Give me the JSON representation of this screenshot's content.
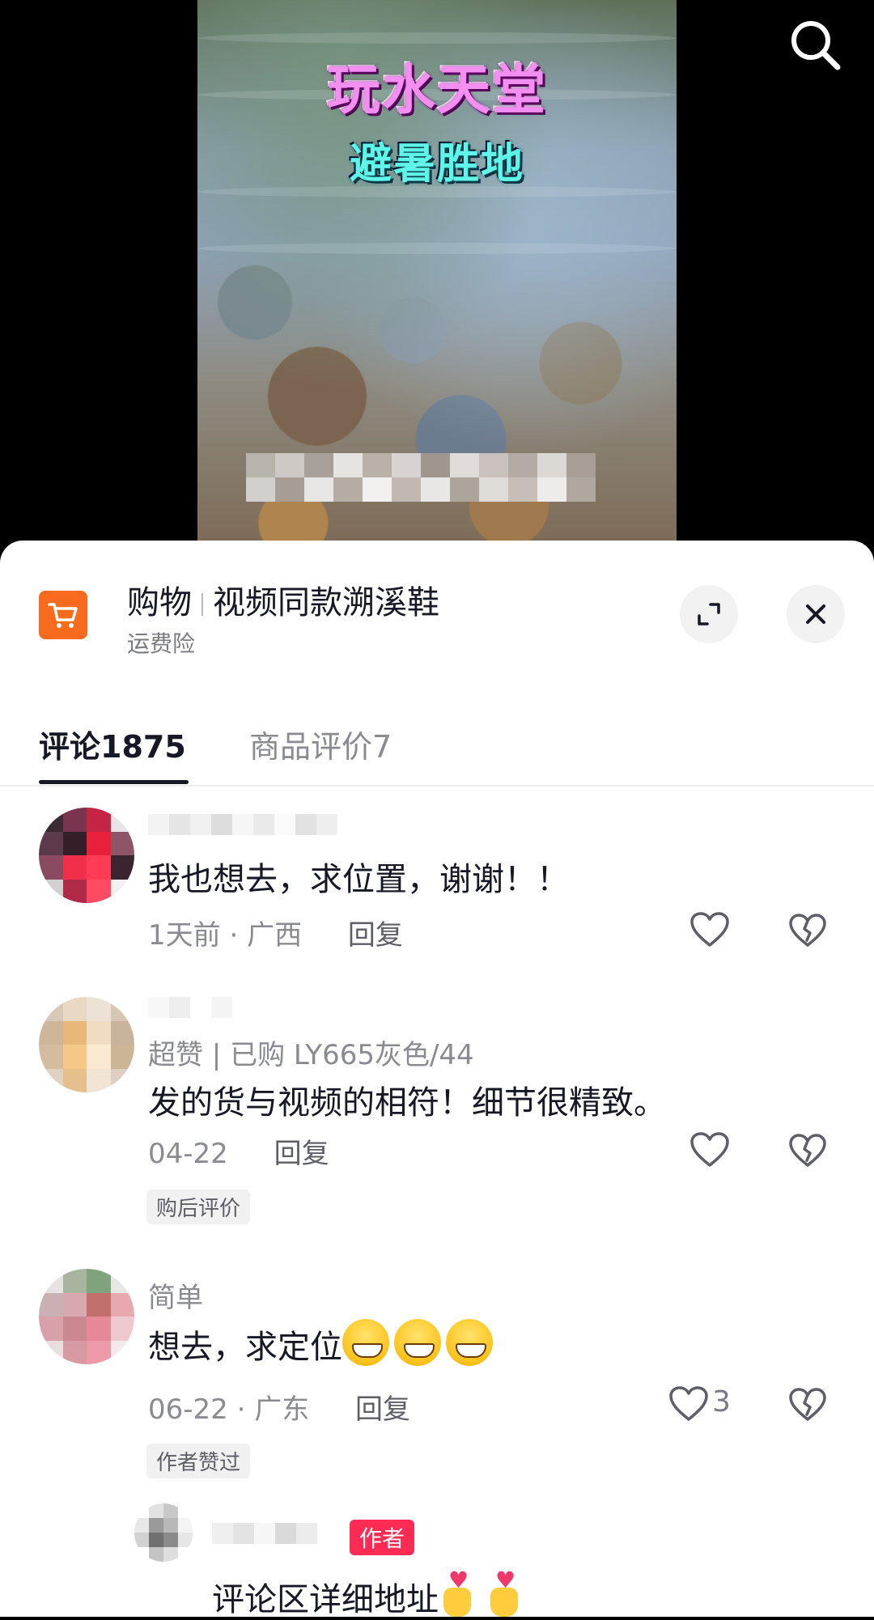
{
  "video": {
    "title": "玩水天堂",
    "subtitle": "避暑胜地"
  },
  "shop": {
    "category": "购物",
    "product": "视频同款溯溪鞋",
    "subtitle": "运费险"
  },
  "tabs": [
    {
      "label": "评论1875",
      "active": true
    },
    {
      "label": "商品评价7",
      "active": false
    }
  ],
  "comments": [
    {
      "text": "我也想去，求位置，谢谢！！",
      "time": "1天前",
      "location": "广西",
      "reply_label": "回复"
    },
    {
      "purchase_info": "超赞 | 已购 LY665灰色/44",
      "text": "发的货与视频的相符！细节很精致。",
      "time": "04-22",
      "reply_label": "回复",
      "tag": "购后评价"
    },
    {
      "username": "简单",
      "text": "想去，求定位",
      "time": "06-22",
      "location": "广东",
      "reply_label": "回复",
      "like_count": "3",
      "tag": "作者赞过",
      "reply": {
        "badge": "作者",
        "text": "评论区详细地址"
      }
    }
  ],
  "colors": {
    "accent_orange": "#f86a1d",
    "author_badge": "#fe2c55"
  }
}
